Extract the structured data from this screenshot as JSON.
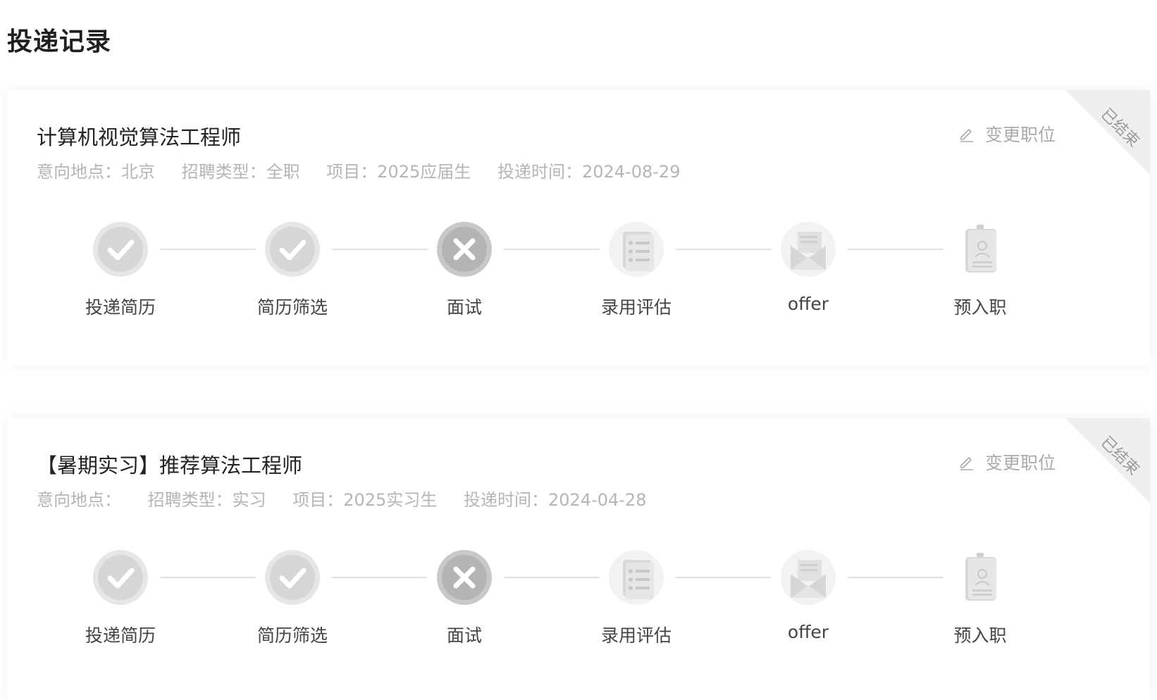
{
  "page": {
    "title": "投递记录"
  },
  "applications": [
    {
      "job_title": "计算机视觉算法工程师",
      "location": "意向地点：北京",
      "type": "招聘类型：全职",
      "project": "项目：2025应届生",
      "date": "投递时间：2024-08-29",
      "change_label": "变更职位",
      "status_ribbon": "已结束",
      "steps": [
        {
          "label": "投递简历",
          "icon": "check-icon",
          "state": "passed"
        },
        {
          "label": "简历筛选",
          "icon": "check-icon",
          "state": "passed"
        },
        {
          "label": "面试",
          "icon": "cross-icon",
          "state": "failed"
        },
        {
          "label": "录用评估",
          "icon": "checklist-icon",
          "state": "pending"
        },
        {
          "label": "offer",
          "icon": "envelope-icon",
          "state": "pending"
        },
        {
          "label": "预入职",
          "icon": "badge-icon",
          "state": "pending"
        }
      ]
    },
    {
      "job_title": "【暑期实习】推荐算法工程师",
      "location": "意向地点：",
      "type": "招聘类型：实习",
      "project": "项目：2025实习生",
      "date": "投递时间：2024-04-28",
      "change_label": "变更职位",
      "status_ribbon": "已结束",
      "steps": [
        {
          "label": "投递简历",
          "icon": "check-icon",
          "state": "passed"
        },
        {
          "label": "简历筛选",
          "icon": "check-icon",
          "state": "passed"
        },
        {
          "label": "面试",
          "icon": "cross-icon",
          "state": "failed"
        },
        {
          "label": "录用评估",
          "icon": "checklist-icon",
          "state": "pending"
        },
        {
          "label": "offer",
          "icon": "envelope-icon",
          "state": "pending"
        },
        {
          "label": "预入职",
          "icon": "badge-icon",
          "state": "pending"
        }
      ]
    }
  ]
}
